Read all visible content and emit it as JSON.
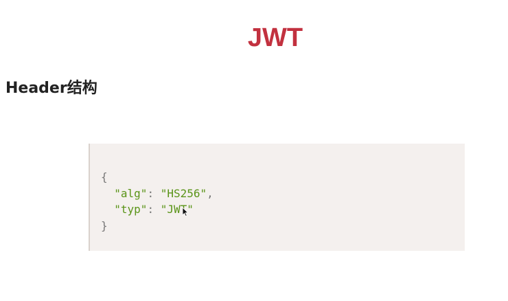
{
  "slide": {
    "title": "JWT",
    "heading": "Header结构"
  },
  "code": {
    "open_brace": "{",
    "close_brace": "}",
    "lines": [
      {
        "key": "\"alg\"",
        "sep": ": ",
        "value": "\"HS256\"",
        "trail": ","
      },
      {
        "key": "\"typ\"",
        "sep": ": ",
        "value": "\"JWT\"",
        "trail": ""
      }
    ]
  },
  "colors": {
    "title": "#c2313f",
    "string": "#5a9418",
    "code_background": "#f4f0ee"
  },
  "icons": {
    "cursor": "mouse-pointer-icon"
  }
}
